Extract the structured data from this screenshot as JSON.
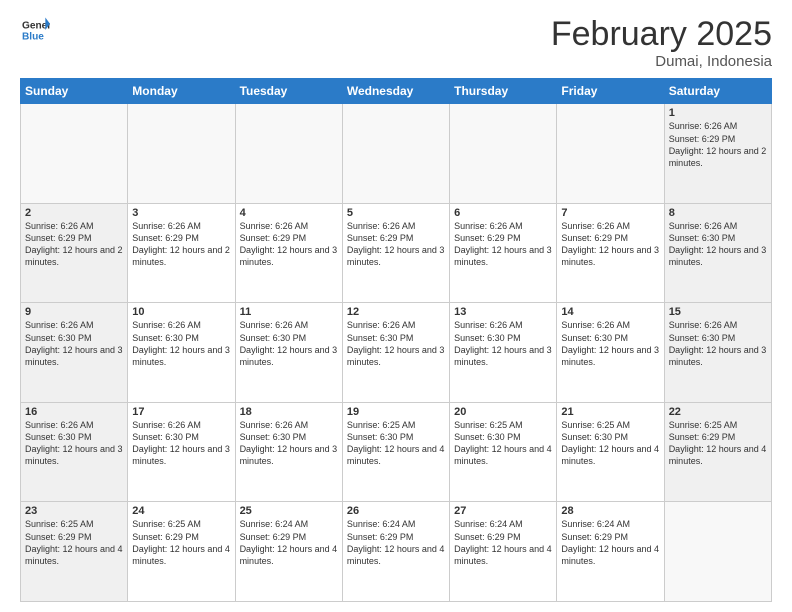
{
  "header": {
    "logo_general": "General",
    "logo_blue": "Blue",
    "title": "February 2025",
    "subtitle": "Dumai, Indonesia"
  },
  "calendar": {
    "days_of_week": [
      "Sunday",
      "Monday",
      "Tuesday",
      "Wednesday",
      "Thursday",
      "Friday",
      "Saturday"
    ],
    "weeks": [
      [
        {
          "day": "",
          "info": ""
        },
        {
          "day": "",
          "info": ""
        },
        {
          "day": "",
          "info": ""
        },
        {
          "day": "",
          "info": ""
        },
        {
          "day": "",
          "info": ""
        },
        {
          "day": "",
          "info": ""
        },
        {
          "day": "1",
          "info": "Sunrise: 6:26 AM\nSunset: 6:29 PM\nDaylight: 12 hours and 2 minutes."
        }
      ],
      [
        {
          "day": "2",
          "info": "Sunrise: 6:26 AM\nSunset: 6:29 PM\nDaylight: 12 hours and 2 minutes."
        },
        {
          "day": "3",
          "info": "Sunrise: 6:26 AM\nSunset: 6:29 PM\nDaylight: 12 hours and 2 minutes."
        },
        {
          "day": "4",
          "info": "Sunrise: 6:26 AM\nSunset: 6:29 PM\nDaylight: 12 hours and 3 minutes."
        },
        {
          "day": "5",
          "info": "Sunrise: 6:26 AM\nSunset: 6:29 PM\nDaylight: 12 hours and 3 minutes."
        },
        {
          "day": "6",
          "info": "Sunrise: 6:26 AM\nSunset: 6:29 PM\nDaylight: 12 hours and 3 minutes."
        },
        {
          "day": "7",
          "info": "Sunrise: 6:26 AM\nSunset: 6:29 PM\nDaylight: 12 hours and 3 minutes."
        },
        {
          "day": "8",
          "info": "Sunrise: 6:26 AM\nSunset: 6:30 PM\nDaylight: 12 hours and 3 minutes."
        }
      ],
      [
        {
          "day": "9",
          "info": "Sunrise: 6:26 AM\nSunset: 6:30 PM\nDaylight: 12 hours and 3 minutes."
        },
        {
          "day": "10",
          "info": "Sunrise: 6:26 AM\nSunset: 6:30 PM\nDaylight: 12 hours and 3 minutes."
        },
        {
          "day": "11",
          "info": "Sunrise: 6:26 AM\nSunset: 6:30 PM\nDaylight: 12 hours and 3 minutes."
        },
        {
          "day": "12",
          "info": "Sunrise: 6:26 AM\nSunset: 6:30 PM\nDaylight: 12 hours and 3 minutes."
        },
        {
          "day": "13",
          "info": "Sunrise: 6:26 AM\nSunset: 6:30 PM\nDaylight: 12 hours and 3 minutes."
        },
        {
          "day": "14",
          "info": "Sunrise: 6:26 AM\nSunset: 6:30 PM\nDaylight: 12 hours and 3 minutes."
        },
        {
          "day": "15",
          "info": "Sunrise: 6:26 AM\nSunset: 6:30 PM\nDaylight: 12 hours and 3 minutes."
        }
      ],
      [
        {
          "day": "16",
          "info": "Sunrise: 6:26 AM\nSunset: 6:30 PM\nDaylight: 12 hours and 3 minutes."
        },
        {
          "day": "17",
          "info": "Sunrise: 6:26 AM\nSunset: 6:30 PM\nDaylight: 12 hours and 3 minutes."
        },
        {
          "day": "18",
          "info": "Sunrise: 6:26 AM\nSunset: 6:30 PM\nDaylight: 12 hours and 3 minutes."
        },
        {
          "day": "19",
          "info": "Sunrise: 6:25 AM\nSunset: 6:30 PM\nDaylight: 12 hours and 4 minutes."
        },
        {
          "day": "20",
          "info": "Sunrise: 6:25 AM\nSunset: 6:30 PM\nDaylight: 12 hours and 4 minutes."
        },
        {
          "day": "21",
          "info": "Sunrise: 6:25 AM\nSunset: 6:30 PM\nDaylight: 12 hours and 4 minutes."
        },
        {
          "day": "22",
          "info": "Sunrise: 6:25 AM\nSunset: 6:29 PM\nDaylight: 12 hours and 4 minutes."
        }
      ],
      [
        {
          "day": "23",
          "info": "Sunrise: 6:25 AM\nSunset: 6:29 PM\nDaylight: 12 hours and 4 minutes."
        },
        {
          "day": "24",
          "info": "Sunrise: 6:25 AM\nSunset: 6:29 PM\nDaylight: 12 hours and 4 minutes."
        },
        {
          "day": "25",
          "info": "Sunrise: 6:24 AM\nSunset: 6:29 PM\nDaylight: 12 hours and 4 minutes."
        },
        {
          "day": "26",
          "info": "Sunrise: 6:24 AM\nSunset: 6:29 PM\nDaylight: 12 hours and 4 minutes."
        },
        {
          "day": "27",
          "info": "Sunrise: 6:24 AM\nSunset: 6:29 PM\nDaylight: 12 hours and 4 minutes."
        },
        {
          "day": "28",
          "info": "Sunrise: 6:24 AM\nSunset: 6:29 PM\nDaylight: 12 hours and 4 minutes."
        },
        {
          "day": "",
          "info": ""
        }
      ]
    ]
  }
}
